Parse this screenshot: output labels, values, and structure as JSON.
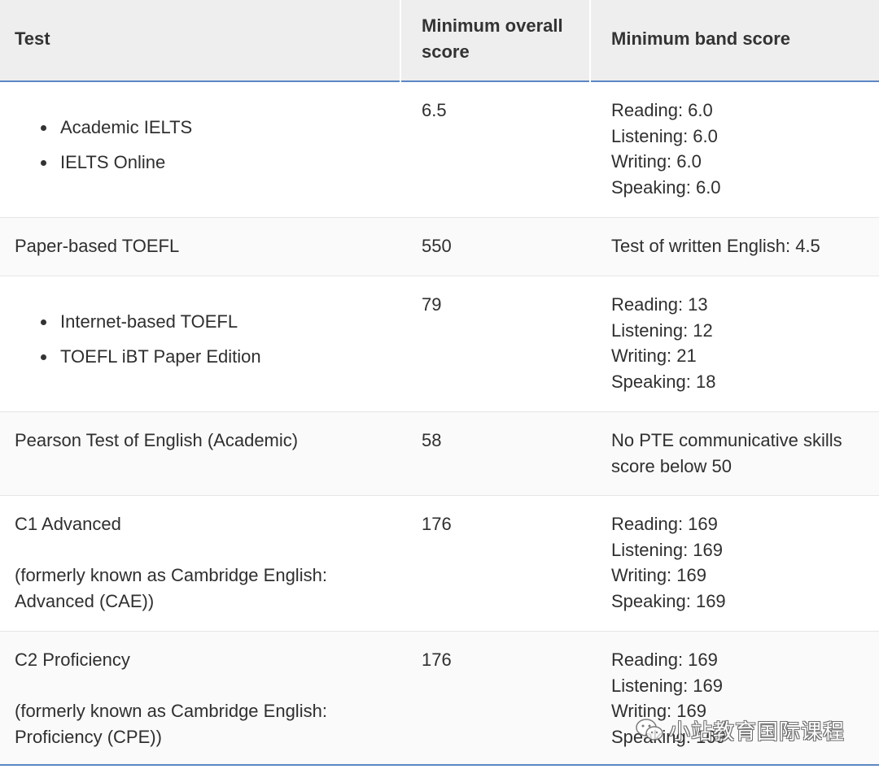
{
  "table": {
    "headers": [
      "Test",
      "Minimum overall score",
      "Minimum band score"
    ],
    "header_lines": {
      "col1": [
        "Test"
      ],
      "col2": [
        "Minimum overall",
        "score"
      ],
      "col3": [
        "Minimum band score"
      ]
    },
    "rows": [
      {
        "test_items": [
          "Academic IELTS",
          "IELTS Online"
        ],
        "overall": "6.5",
        "band": [
          "Reading: 6.0",
          "Listening: 6.0",
          "Writing: 6.0",
          "Speaking: 6.0"
        ]
      },
      {
        "test": "Paper-based TOEFL",
        "overall": "550",
        "band": [
          "Test of written English: 4.5"
        ]
      },
      {
        "test_items": [
          "Internet-based TOEFL",
          "TOEFL iBT Paper Edition"
        ],
        "overall": "79",
        "band": [
          "Reading: 13",
          "Listening: 12",
          "Writing: 21",
          "Speaking: 18"
        ]
      },
      {
        "test": "Pearson Test of English (Academic)",
        "overall": "58",
        "band": [
          "No PTE communicative skills",
          "score below 50"
        ]
      },
      {
        "test": "C1 Advanced",
        "test_note": [
          "(formerly known as Cambridge English:",
          "Advanced (CAE))"
        ],
        "overall": "176",
        "band": [
          "Reading: 169",
          "Listening: 169",
          "Writing: 169",
          "Speaking: 169"
        ]
      },
      {
        "test": "C2 Proficiency",
        "test_note": [
          "(formerly known as Cambridge English:",
          "Proficiency (CPE))"
        ],
        "overall": "176",
        "band": [
          "Reading: 169",
          "Listening: 169",
          "Writing: 169",
          "Speaking: 169"
        ]
      }
    ]
  },
  "watermark": {
    "text": "小站教育国际课程",
    "icon": "wechat-icon"
  },
  "colors": {
    "header_bg": "#eeeeee",
    "accent_rule": "#5b87c5",
    "row_divider": "#e6e6e6",
    "text": "#2f2f2f"
  }
}
